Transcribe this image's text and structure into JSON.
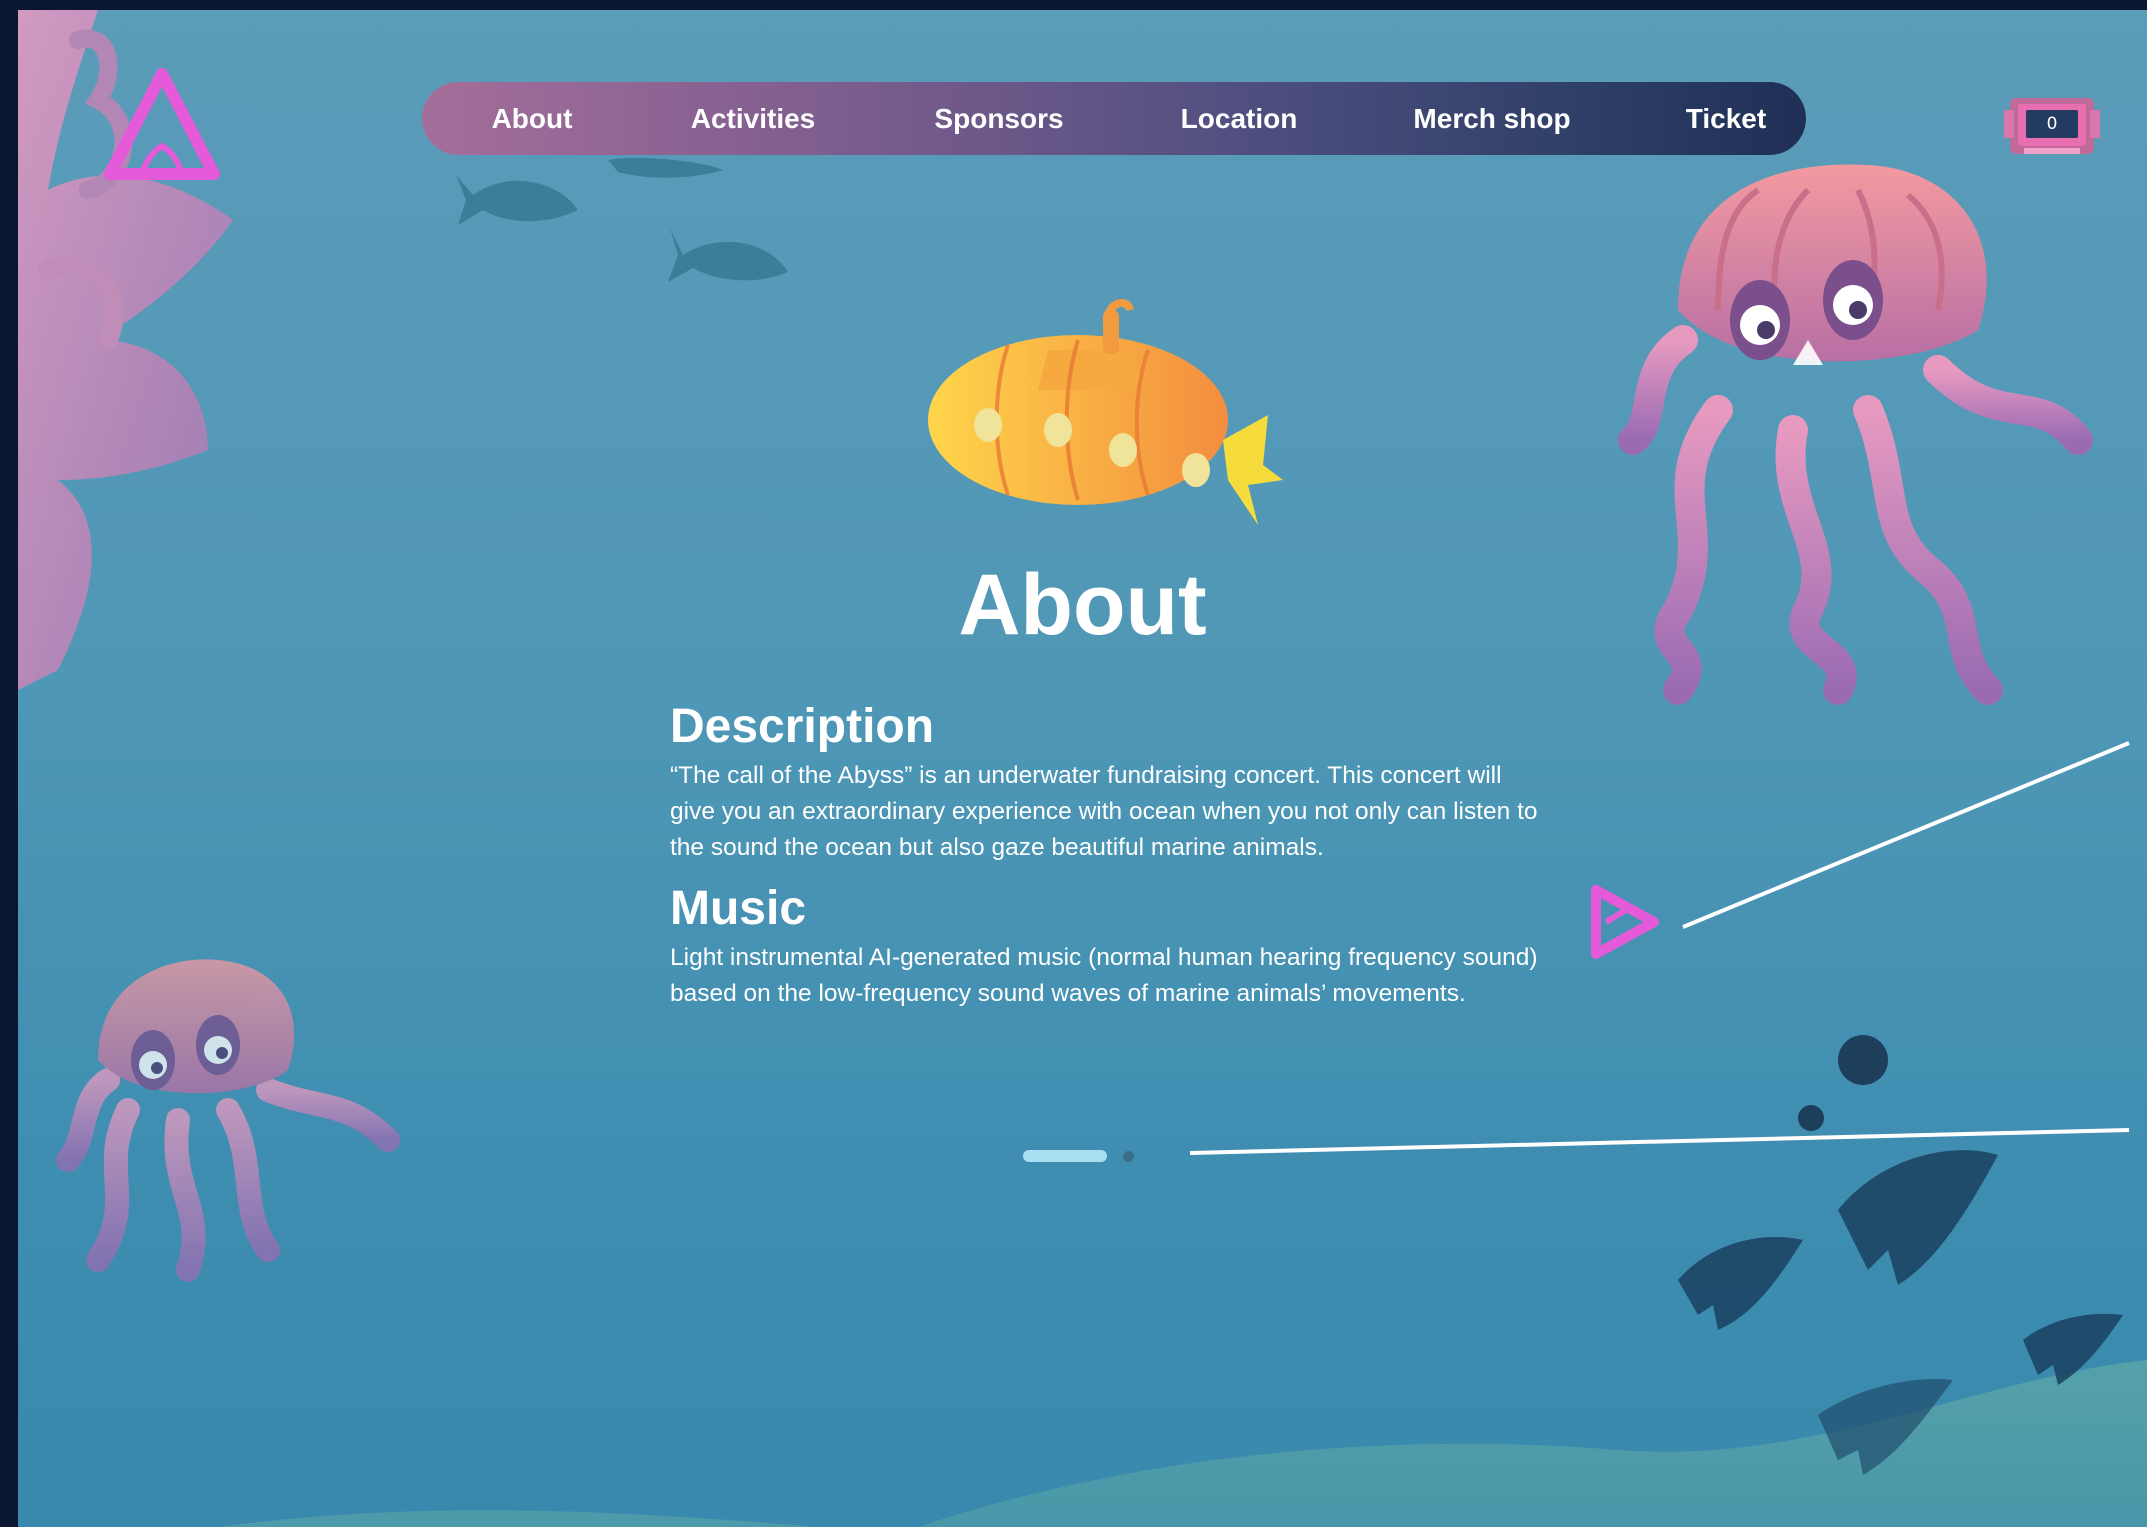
{
  "nav": {
    "items": [
      "About",
      "Activities",
      "Sponsors",
      "Location",
      "Merch shop",
      "Ticket"
    ]
  },
  "cart": {
    "count": "0"
  },
  "page": {
    "title": "About"
  },
  "sections": {
    "description": {
      "heading": "Description",
      "text": "“The call of the Abyss” is an underwater fundraising concert. This concert will give you an extraordinary experience with ocean when you not only can listen to the sound the ocean but also gaze beautiful marine animals."
    },
    "music": {
      "heading": "Music",
      "text": "Light instrumental AI-generated music (normal human hearing frequency sound) based on the low-frequency sound waves of marine animals’ movements."
    }
  },
  "pagination": {
    "active_page": 1,
    "total_pages": 2
  },
  "colors": {
    "ocean": "#4f97b6",
    "accent_pink": "#e45ad9",
    "nav_start": "#a56e9a",
    "nav_end": "#1f2f55",
    "pager_active": "#a9dff3"
  },
  "icons": {
    "logo": "triangle-logo-icon",
    "cart": "cart-icon",
    "next": "next-arrow-icon"
  }
}
